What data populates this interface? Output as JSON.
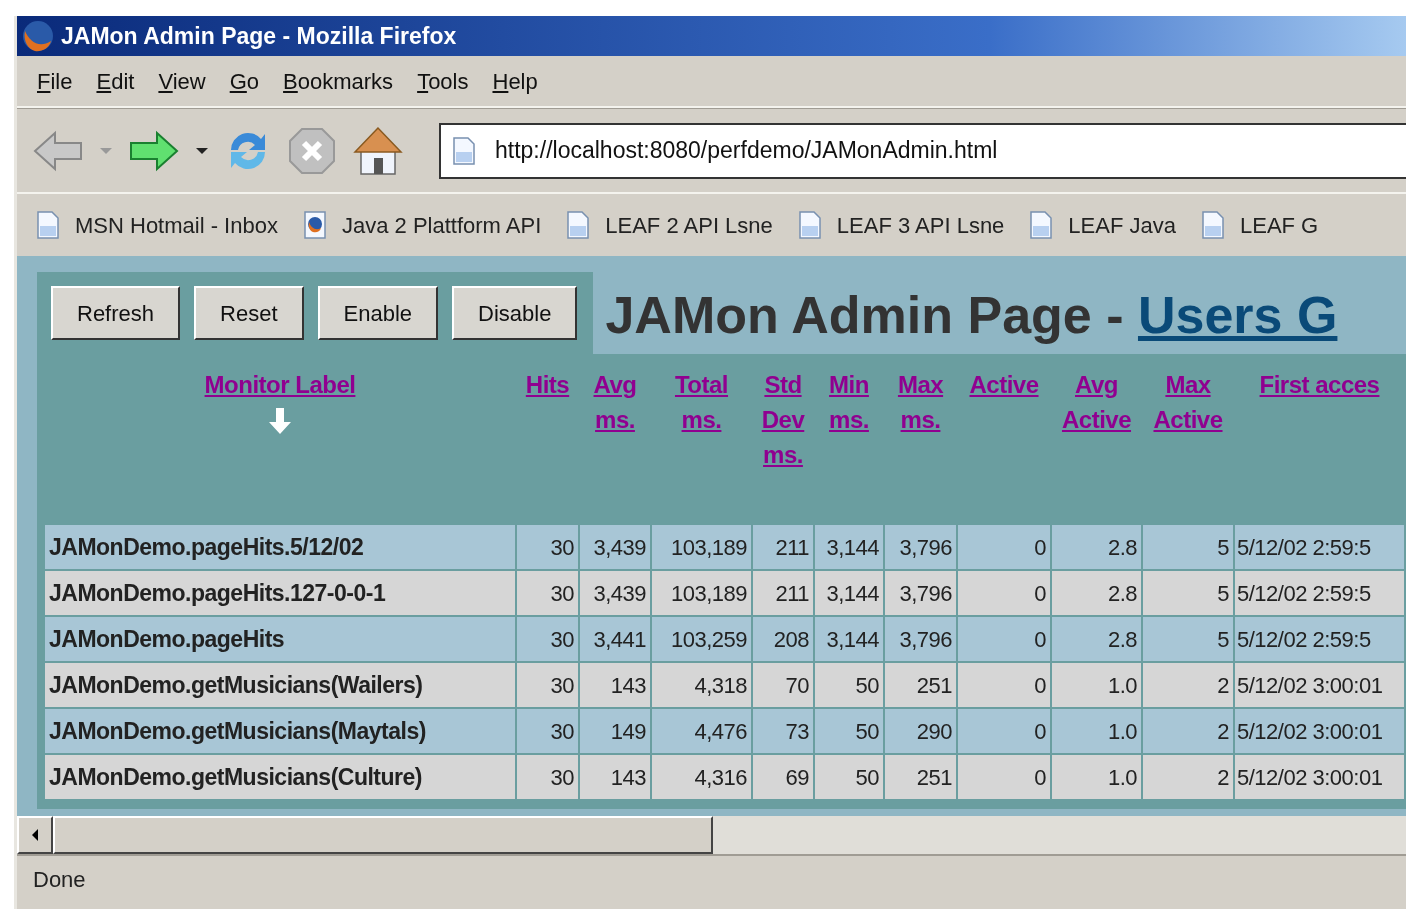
{
  "window": {
    "title": "JAMon Admin Page - Mozilla Firefox"
  },
  "menu": [
    "File",
    "Edit",
    "View",
    "Go",
    "Bookmarks",
    "Tools",
    "Help"
  ],
  "toolbar": [
    {
      "kind": "back",
      "disabled": true
    },
    {
      "kind": "forward",
      "disabled": false
    },
    {
      "kind": "reload",
      "disabled": false
    },
    {
      "kind": "stop",
      "disabled": true
    },
    {
      "kind": "home",
      "disabled": false
    }
  ],
  "address": {
    "value": "http://localhost:8080/perfdemo/JAMonAdmin.html"
  },
  "bookmarks": [
    {
      "label": "MSN Hotmail - Inbox",
      "kind": "page"
    },
    {
      "label": "Java 2 Plattform API",
      "kind": "browser"
    },
    {
      "label": "LEAF 2 API Lsne",
      "kind": "page"
    },
    {
      "label": "LEAF 3 API Lsne",
      "kind": "page"
    },
    {
      "label": "LEAF Java",
      "kind": "page"
    },
    {
      "label": "LEAF G",
      "kind": "page"
    }
  ],
  "admin": {
    "buttons": [
      "Refresh",
      "Reset",
      "Enable",
      "Disable"
    ],
    "heading": "JAMon Admin Page - ",
    "heading_link": "Users G"
  },
  "table": {
    "columns": [
      {
        "label": "Monitor Label",
        "sorted": true
      },
      {
        "label": "Hits",
        "sorted": false
      },
      {
        "label": "Avg ms.",
        "sorted": false
      },
      {
        "label": "Total ms.",
        "sorted": false
      },
      {
        "label": "Std Dev ms.",
        "sorted": false
      },
      {
        "label": "Min ms.",
        "sorted": false
      },
      {
        "label": "Max ms.",
        "sorted": false
      },
      {
        "label": "Active",
        "sorted": false
      },
      {
        "label": "Avg Active",
        "sorted": false
      },
      {
        "label": "Max Active",
        "sorted": false
      },
      {
        "label": "First acces",
        "sorted": false
      }
    ],
    "rows": [
      [
        "JAMonDemo.pageHits.5/12/02",
        "30",
        "3,439",
        "103,189",
        "211",
        "3,144",
        "3,796",
        "0",
        "2.8",
        "5",
        "5/12/02 2:59:5"
      ],
      [
        "JAMonDemo.pageHits.127-0-0-1",
        "30",
        "3,439",
        "103,189",
        "211",
        "3,144",
        "3,796",
        "0",
        "2.8",
        "5",
        "5/12/02 2:59:5"
      ],
      [
        "JAMonDemo.pageHits",
        "30",
        "3,441",
        "103,259",
        "208",
        "3,144",
        "3,796",
        "0",
        "2.8",
        "5",
        "5/12/02 2:59:5"
      ],
      [
        "JAMonDemo.getMusicians(Wailers)",
        "30",
        "143",
        "4,318",
        "70",
        "50",
        "251",
        "0",
        "1.0",
        "2",
        "5/12/02 3:00:01"
      ],
      [
        "JAMonDemo.getMusicians(Maytals)",
        "30",
        "149",
        "4,476",
        "73",
        "50",
        "290",
        "0",
        "1.0",
        "2",
        "5/12/02 3:00:01"
      ],
      [
        "JAMonDemo.getMusicians(Culture)",
        "30",
        "143",
        "4,316",
        "69",
        "50",
        "251",
        "0",
        "1.0",
        "2",
        "5/12/02 3:00:01"
      ]
    ]
  },
  "status_bar": "Done"
}
